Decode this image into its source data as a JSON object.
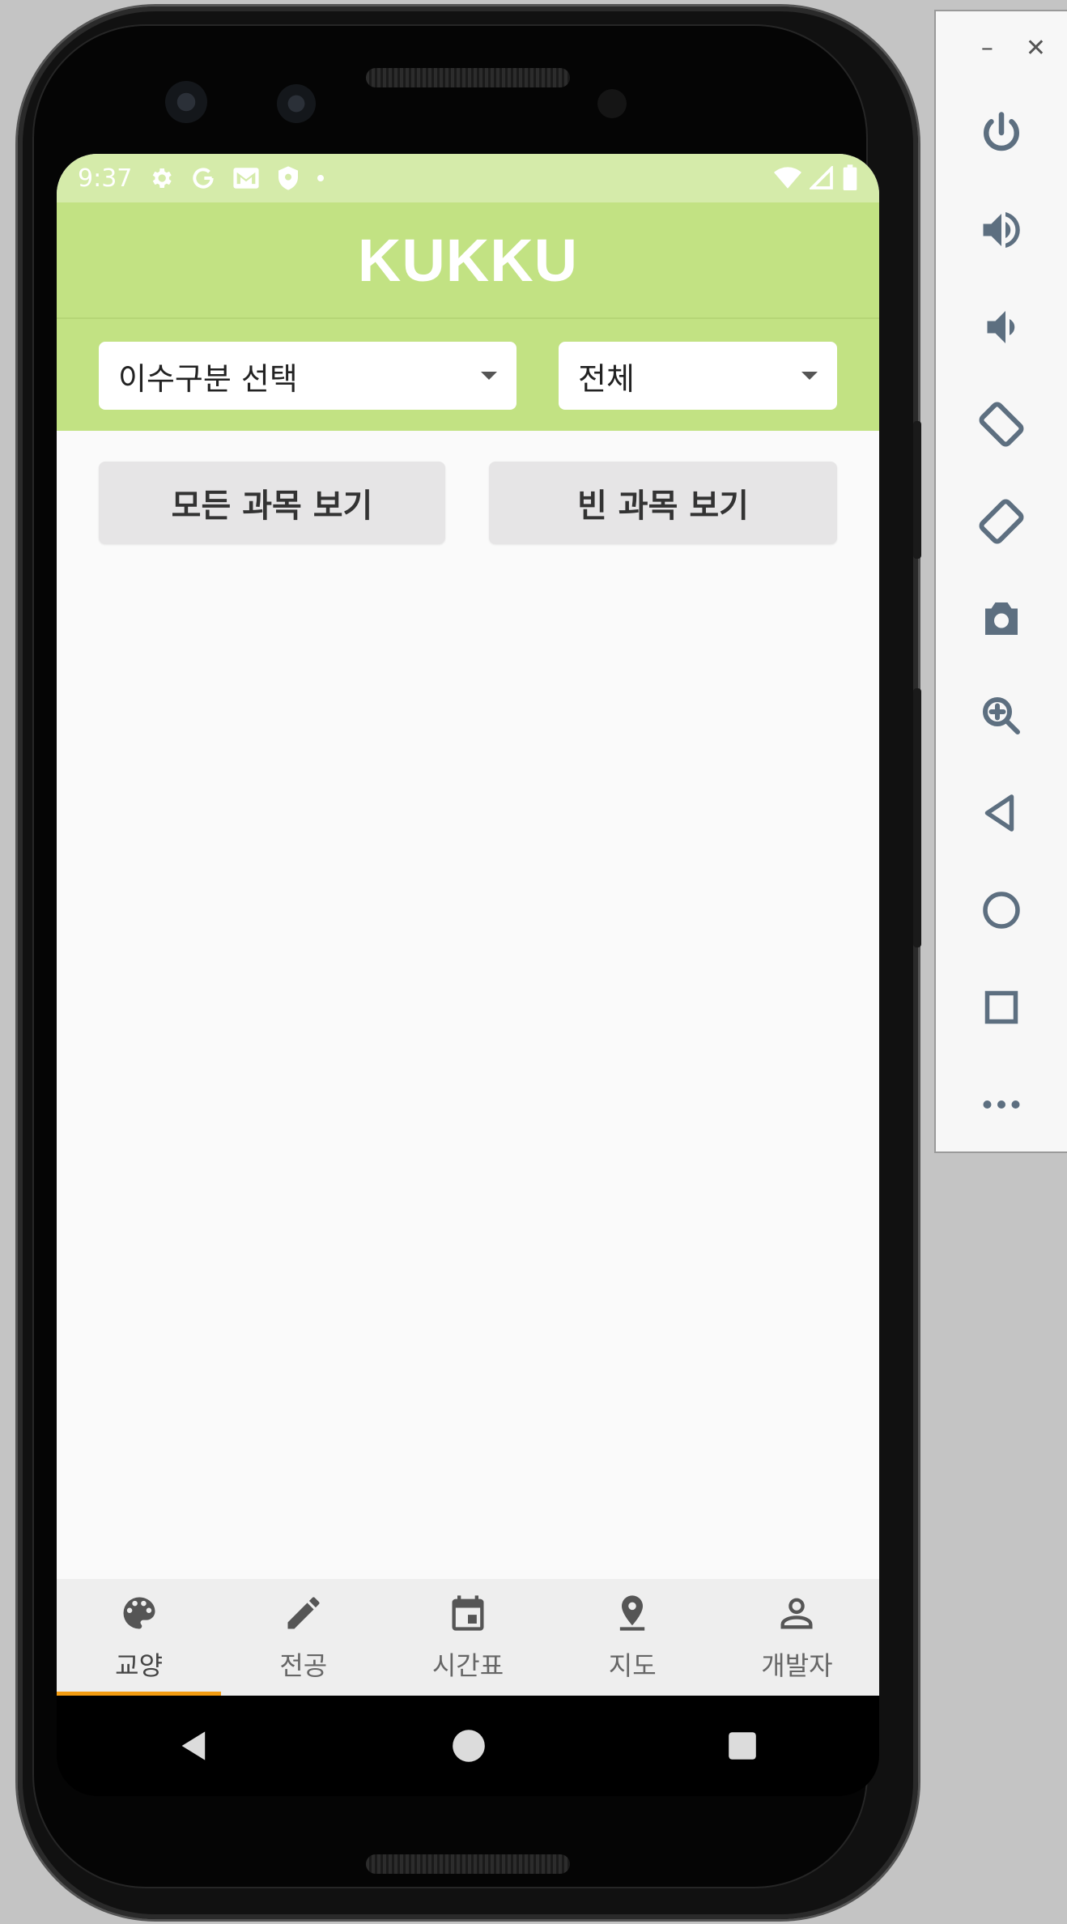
{
  "status_bar": {
    "time": "9:37",
    "left_icons": [
      "gear-icon",
      "google-g-icon",
      "gmail-icon",
      "shield-icon",
      "dot-icon"
    ],
    "right_icons": [
      "wifi-icon",
      "signal-icon",
      "battery-icon"
    ]
  },
  "app": {
    "title": "KUKKU",
    "accent_color": "#c2e283",
    "status_color": "#d5ebaa",
    "indicator_color": "#f39c12"
  },
  "filters": {
    "category_select": "이수구분 선택",
    "scope_select": "전체"
  },
  "buttons": {
    "all_courses": "모든 과목 보기",
    "empty_courses": "빈 과목 보기"
  },
  "bottom_nav": {
    "items": [
      {
        "label": "교양",
        "icon": "palette-icon",
        "active": true
      },
      {
        "label": "전공",
        "icon": "pencil-icon",
        "active": false
      },
      {
        "label": "시간표",
        "icon": "calendar-icon",
        "active": false
      },
      {
        "label": "지도",
        "icon": "map-pin-icon",
        "active": false
      },
      {
        "label": "개발자",
        "icon": "person-icon",
        "active": false
      }
    ]
  },
  "system_nav": [
    "back-icon",
    "home-icon",
    "recents-icon"
  ],
  "emulator_panel": {
    "window_controls": [
      "minimize-icon",
      "close-icon"
    ],
    "tools": [
      "power-icon",
      "volume-up-icon",
      "volume-down-icon",
      "rotate-left-icon",
      "rotate-right-icon",
      "camera-icon",
      "zoom-icon",
      "back-icon",
      "home-icon",
      "overview-icon",
      "more-icon"
    ]
  }
}
